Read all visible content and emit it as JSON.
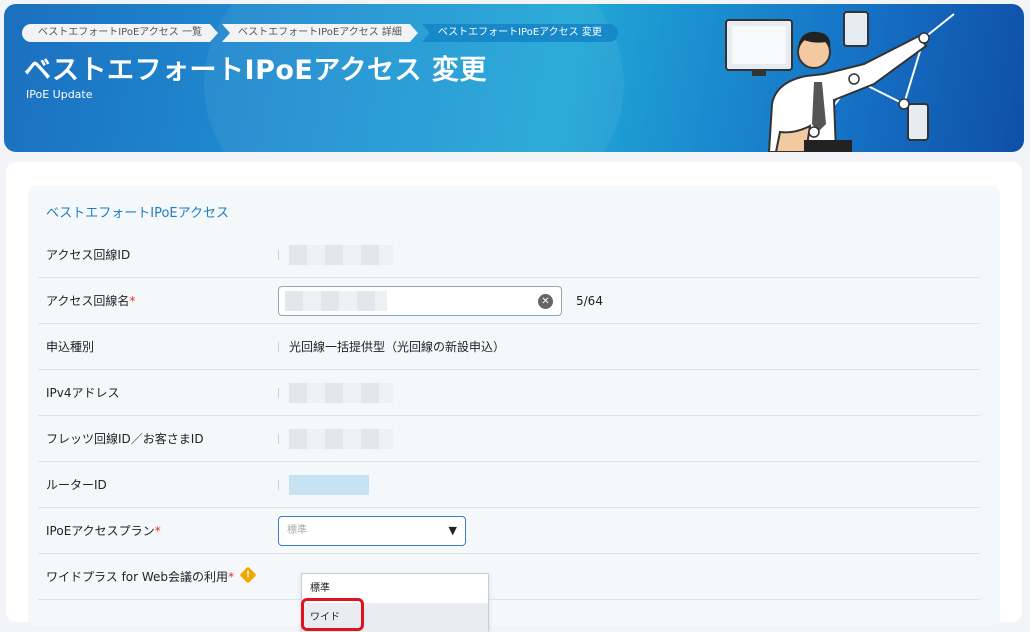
{
  "breadcrumb": [
    {
      "label": "ベストエフォートIPoEアクセス 一覧"
    },
    {
      "label": "ベストエフォートIPoEアクセス 詳細"
    },
    {
      "label": "ベストエフォートIPoEアクセス 変更"
    }
  ],
  "header": {
    "title": "ベストエフォートIPoEアクセス 変更",
    "subtitle": "IPoE Update"
  },
  "section": {
    "title": "ベストエフォートIPoEアクセス"
  },
  "fields": {
    "access_line_id": {
      "label": "アクセス回線ID"
    },
    "access_line_name": {
      "label": "アクセス回線名",
      "required": "*",
      "counter": "5/64",
      "clear_glyph": "✕"
    },
    "application_type": {
      "label": "申込種別",
      "value": "光回線一括提供型（光回線の新設申込）"
    },
    "ipv4_address": {
      "label": "IPv4アドレス"
    },
    "flets_id": {
      "label": "フレッツ回線ID／お客さまID"
    },
    "router_id": {
      "label": "ルーターID"
    },
    "plan": {
      "label": "IPoEアクセスプラン",
      "required": "*",
      "placeholder": "標準",
      "arrow": "▼",
      "options": [
        "標準",
        "ワイド"
      ],
      "hovered_option": "ワイド"
    },
    "wide_plus": {
      "label": "ワイドプラス for Web会議の利用",
      "required": "*",
      "warn_glyph": "!"
    }
  },
  "colors": {
    "accent": "#1c7fbf",
    "required": "#d33333",
    "highlight_box": "#e0141e",
    "warning": "#f2a800"
  }
}
